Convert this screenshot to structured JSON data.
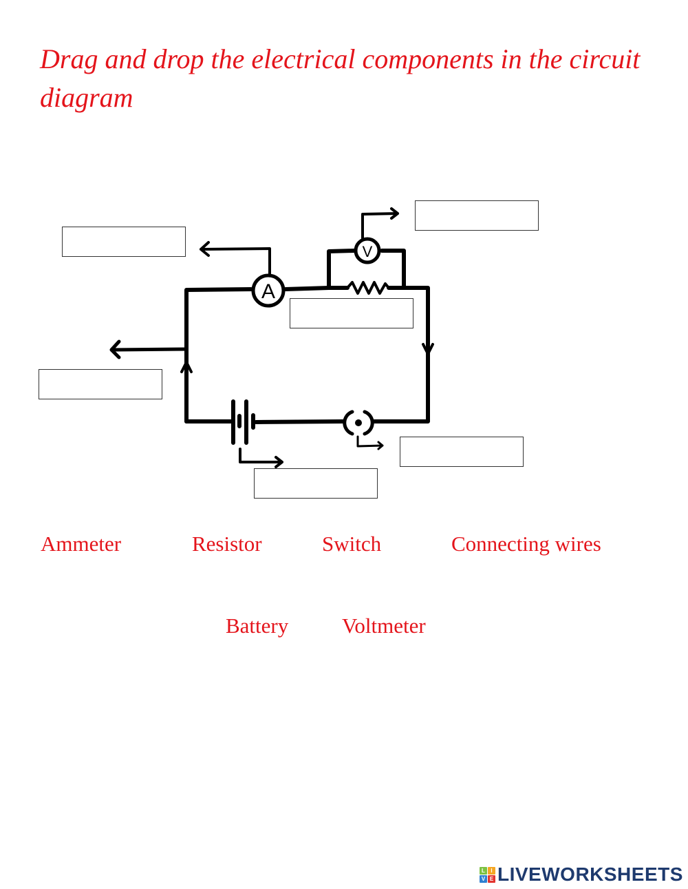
{
  "title": "Drag and drop the electrical components in the circuit diagram",
  "circuit": {
    "ammeter_symbol": "A",
    "voltmeter_symbol": "V"
  },
  "drop_targets": [
    {
      "id": "ammeter-target",
      "value": ""
    },
    {
      "id": "voltmeter-target",
      "value": ""
    },
    {
      "id": "resistor-target",
      "value": ""
    },
    {
      "id": "wires-target",
      "value": ""
    },
    {
      "id": "switch-target",
      "value": ""
    },
    {
      "id": "battery-target",
      "value": ""
    }
  ],
  "draggable_words": [
    {
      "label": "Ammeter"
    },
    {
      "label": "Resistor"
    },
    {
      "label": "Switch"
    },
    {
      "label": "Connecting wires"
    },
    {
      "label": "Battery"
    },
    {
      "label": "Voltmeter"
    }
  ],
  "colors": {
    "accent": "#e4141b",
    "logo_text": "#1e3a6e"
  },
  "logo": {
    "tiles": [
      {
        "letter": "L",
        "color": "#7dc242"
      },
      {
        "letter": "I",
        "color": "#f5a623"
      },
      {
        "letter": "V",
        "color": "#2f80d1"
      },
      {
        "letter": "E",
        "color": "#e3342f"
      }
    ],
    "text": "LIVEWORKSHEETS"
  }
}
